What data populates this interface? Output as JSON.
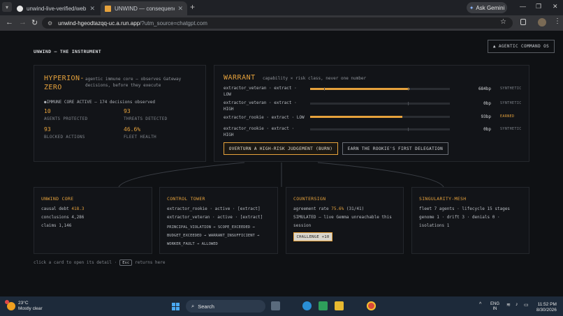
{
  "browser": {
    "tabs": [
      {
        "title": "unwind-live-verified/web at m...",
        "active": false
      },
      {
        "title": "UNWIND — consequence clea...",
        "active": true
      }
    ],
    "ask_gemini": "Ask Gemini",
    "url_host": "unwind-hgeodtazqq-uc.a.run.app",
    "url_path": "/?utm_source=chatgpt.com"
  },
  "header": {
    "brand": "UNWIND — THE INSTRUMENT",
    "command_os_button": "▲ AGENTIC COMMAND OS"
  },
  "hyperion": {
    "title": "HYPERION-ZERO",
    "description": "agentic immune core — observes Gateway decisions, before they execute",
    "status": "●IMMUNE CORE ACTIVE — 174 decisions observed",
    "stats": [
      {
        "value": "10",
        "label": "AGENTS PROTECTED"
      },
      {
        "value": "93",
        "label": "THREATS DETECTED"
      },
      {
        "value": "93",
        "label": "BLOCKED ACTIONS"
      },
      {
        "value": "46.6%",
        "label": "FLEET HEALTH"
      }
    ]
  },
  "warrant": {
    "title": "WARRANT",
    "subtitle": "capability × risk class, never one number",
    "rows": [
      {
        "label": "extractor_veteran · extract · LOW",
        "fill": 0.71,
        "bp": "684bp",
        "tag": "SYNTHETIC"
      },
      {
        "label": "extractor_veteran · extract · HIGH",
        "fill": 0.0,
        "bp": "0bp",
        "tag": "SYNTHETIC"
      },
      {
        "label": "extractor_rookie · extract · LOW",
        "fill": 0.66,
        "bp": "93bp",
        "tag": "EARNED"
      },
      {
        "label": "extractor_rookie · extract · HIGH",
        "fill": 0.0,
        "bp": "0bp",
        "tag": "SYNTHETIC"
      }
    ],
    "burn_button": "OVERTURN A HIGH-RISK JUDGEMENT (BURN)",
    "delegation_button": "EARN THE ROOKIE'S FIRST DELEGATION"
  },
  "cards": {
    "core": {
      "title": "UNWIND CORE",
      "causal_debt_label": "causal debt",
      "causal_debt_value": "418.3",
      "conclusions": "conclusions 4,286",
      "claims": "claims 1,146"
    },
    "tower": {
      "title": "CONTROL TOWER",
      "agent1": "extractor_rookie · active · [extract]",
      "agent2": "extractor_veteran · active · [extract]",
      "flow1": "PRINCIPAL_VIOLATION → SCOPE_EXCEEDED →",
      "flow2": "BUDGET_EXCEEDED → WARRANT_INSUFFICIENT →",
      "flow3": "WORKER_FAULT → ALLOWED"
    },
    "countersign": {
      "title": "COUNTERSIGN",
      "rate_label": "agreement rate",
      "rate_pct": "75.6%",
      "rate_frac": "(31/41)",
      "simulated1": "SIMULATED — live Gemma unreachable this",
      "simulated2": "session",
      "challenge": "CHALLENGE +10"
    },
    "mesh": {
      "title": "SINGULARITY-MESH",
      "fleet": "fleet 7 agents · lifecycle 15 stages",
      "genome": "genome 1 · drift 3 · denials 0 ·",
      "isolations": "isolations 1"
    }
  },
  "hint": {
    "before": "click a card to open its detail ·",
    "key": "Esc",
    "after": "returns here"
  },
  "taskbar": {
    "temp": "23°C",
    "weather": "Mostly clear",
    "search": "Search",
    "lang1": "ENG",
    "lang2": "IN",
    "time": "11:52 PM",
    "date": "8/30/2026"
  }
}
